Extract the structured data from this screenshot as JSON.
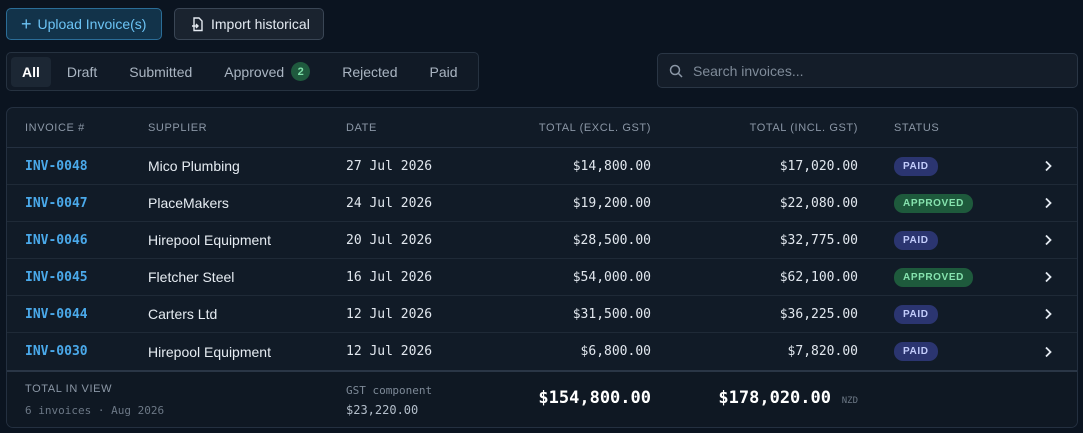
{
  "toolbar": {
    "upload_label": "Upload Invoice(s)",
    "import_label": "Import historical"
  },
  "tabs": [
    {
      "label": "All",
      "active": true
    },
    {
      "label": "Draft"
    },
    {
      "label": "Submitted"
    },
    {
      "label": "Approved",
      "count": "2"
    },
    {
      "label": "Rejected"
    },
    {
      "label": "Paid"
    }
  ],
  "search": {
    "placeholder": "Search invoices..."
  },
  "table": {
    "headers": {
      "invoice": "INVOICE #",
      "supplier": "SUPPLIER",
      "date": "DATE",
      "excl": "TOTAL (EXCL. GST)",
      "incl": "TOTAL (INCL. GST)",
      "status": "STATUS"
    },
    "rows": [
      {
        "invoice": "INV-0048",
        "supplier": "Mico Plumbing",
        "date": "27 Jul 2026",
        "excl": "$14,800.00",
        "incl": "$17,020.00",
        "status": "PAID"
      },
      {
        "invoice": "INV-0047",
        "supplier": "PlaceMakers",
        "date": "24 Jul 2026",
        "excl": "$19,200.00",
        "incl": "$22,080.00",
        "status": "APPROVED"
      },
      {
        "invoice": "INV-0046",
        "supplier": "Hirepool Equipment",
        "date": "20 Jul 2026",
        "excl": "$28,500.00",
        "incl": "$32,775.00",
        "status": "PAID"
      },
      {
        "invoice": "INV-0045",
        "supplier": "Fletcher Steel",
        "date": "16 Jul 2026",
        "excl": "$54,000.00",
        "incl": "$62,100.00",
        "status": "APPROVED"
      },
      {
        "invoice": "INV-0044",
        "supplier": "Carters Ltd",
        "date": "12 Jul 2026",
        "excl": "$31,500.00",
        "incl": "$36,225.00",
        "status": "PAID"
      },
      {
        "invoice": "INV-0030",
        "supplier": "Hirepool Equipment",
        "date": "12 Jul 2026",
        "excl": "$6,800.00",
        "incl": "$7,820.00",
        "status": "PAID"
      }
    ]
  },
  "footer": {
    "title": "TOTAL IN VIEW",
    "subtitle": "6 invoices · Aug 2026",
    "gst_label": "GST component",
    "gst_value": "$23,220.00",
    "total_excl": "$154,800.00",
    "total_incl": "$178,020.00",
    "currency": "NZD"
  },
  "colors": {
    "background": "#0b1420",
    "accent": "#4aa9ea",
    "paid_badge": "#2b3570",
    "approved_badge": "#1e5a3c"
  },
  "icons": {
    "upload": "plus-icon",
    "import": "file-import-icon",
    "search": "search-icon",
    "row_action": "chevron-right-icon"
  }
}
